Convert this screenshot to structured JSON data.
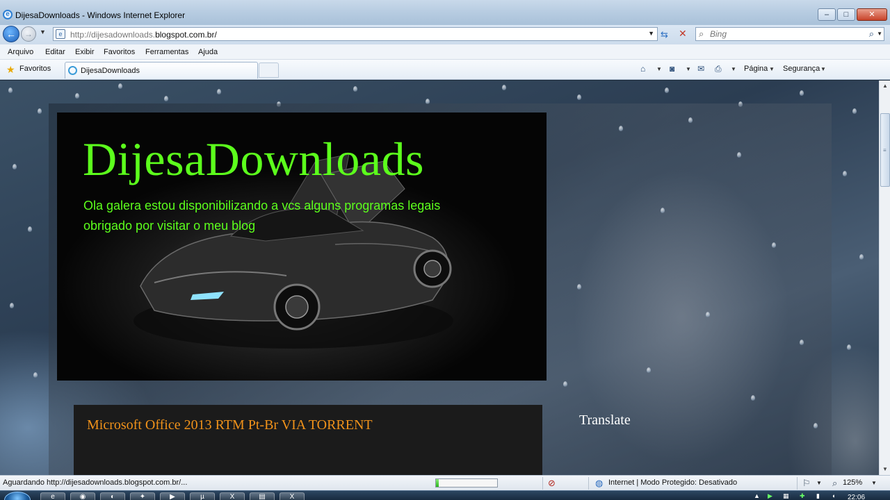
{
  "window": {
    "title": "DijesaDownloads - Windows Internet Explorer",
    "buttons": {
      "minimize": "‒",
      "maximize": "□",
      "close": "✕"
    }
  },
  "address": {
    "url_prefix": "http://dijesadownloads.",
    "url_domain": "blogspot.com.br/",
    "search_placeholder": "Bing"
  },
  "menu": [
    "Arquivo",
    "Editar",
    "Exibir",
    "Favoritos",
    "Ferramentas",
    "Ajuda"
  ],
  "favorites_bar": {
    "favorites_label": "Favoritos",
    "tab_title": "DijesaDownloads",
    "page_menu": "Página",
    "safety_menu": "Segurança"
  },
  "page": {
    "blog_title": "DijesaDownloads",
    "blog_description_line1": "Ola galera estou disponibilizando a vcs alguns programas legais",
    "blog_description_line2": "obrigado por visitar o meu blog",
    "post_title": "Microsoft Office 2013 RTM Pt-Br VIA TORRENT",
    "widget_title": "Translate"
  },
  "status": {
    "text": "Aguardando http://dijesadownloads.blogspot.com.br/...",
    "progress": 0.04,
    "zone": "Internet | Modo Protegido: Desativado",
    "zoom": "125%"
  },
  "taskbar": {
    "clock": "22:06"
  },
  "colors": {
    "blog_title": "#5cff1c",
    "post_title": "#f0921a",
    "widget_title": "#ffffff"
  },
  "icons": [
    "ie-icon",
    "back-arrow-icon",
    "forward-arrow-icon",
    "page-icon",
    "refresh-icon",
    "stop-icon",
    "search-icon",
    "star-icon",
    "home-icon",
    "rss-icon",
    "mail-icon",
    "print-icon",
    "globe-icon",
    "zoom-icon",
    "windows-start-icon"
  ]
}
